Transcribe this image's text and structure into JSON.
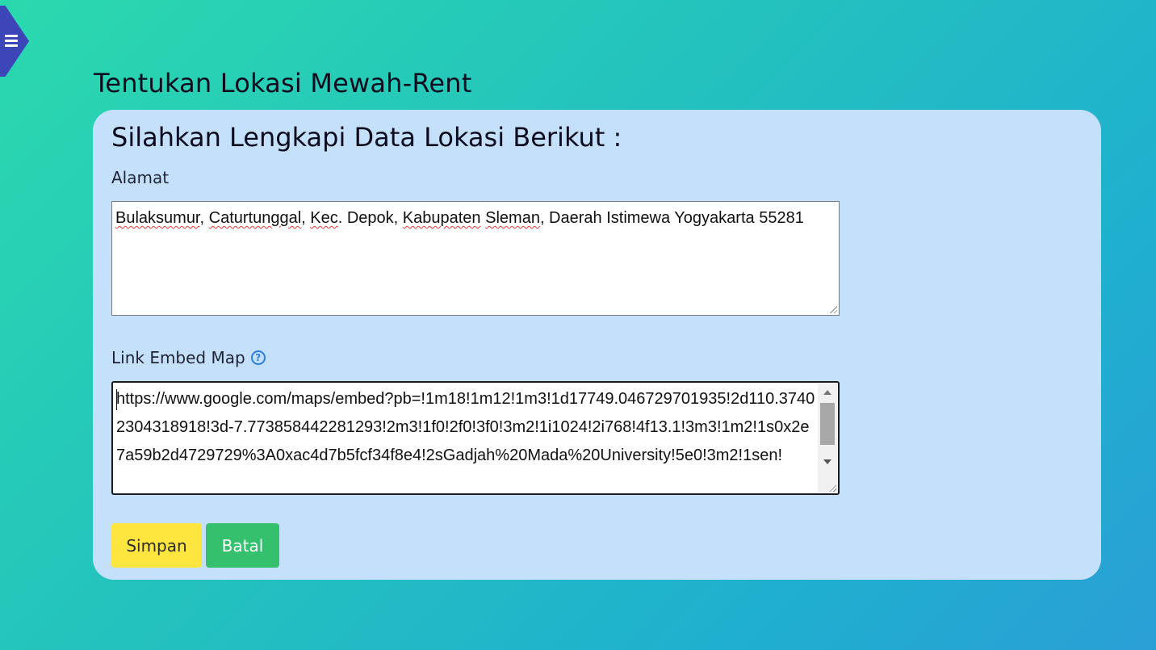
{
  "header": {
    "title": "Tentukan Lokasi Mewah-Rent"
  },
  "form": {
    "title": "Silahkan Lengkapi Data Lokasi Berikut :",
    "alamat": {
      "label": "Alamat",
      "value_parts": [
        "Bulaksumur",
        ", ",
        "Caturtunggal",
        ", ",
        "Kec",
        ". Depok, ",
        "Kabupaten",
        " ",
        "Sleman",
        ", Daerah Istimewa Yogyakarta 55281"
      ]
    },
    "link_embed": {
      "label": "Link Embed Map",
      "help_icon": "question-circle-icon",
      "value": "https://www.google.com/maps/embed?pb=!1m18!1m12!1m3!1d17749.046729701935!2d110.37402304318918!3d-7.773858442281293!2m3!1f0!2f0!3f0!3m2!1i1024!2i768!4f13.1!3m3!1m2!1s0x2e7a59b2d4729729%3A0xac4d7b5fcf34f8e4!2sGadjah%20Mada%20University!5e0!3m2!1sen!"
    },
    "buttons": {
      "save": "Simpan",
      "cancel": "Batal"
    }
  },
  "colors": {
    "card_bg": "#c4e0fb",
    "save_bg": "#ffe63f",
    "cancel_bg": "#34c06d",
    "menu_bg": "#3d46b8"
  }
}
